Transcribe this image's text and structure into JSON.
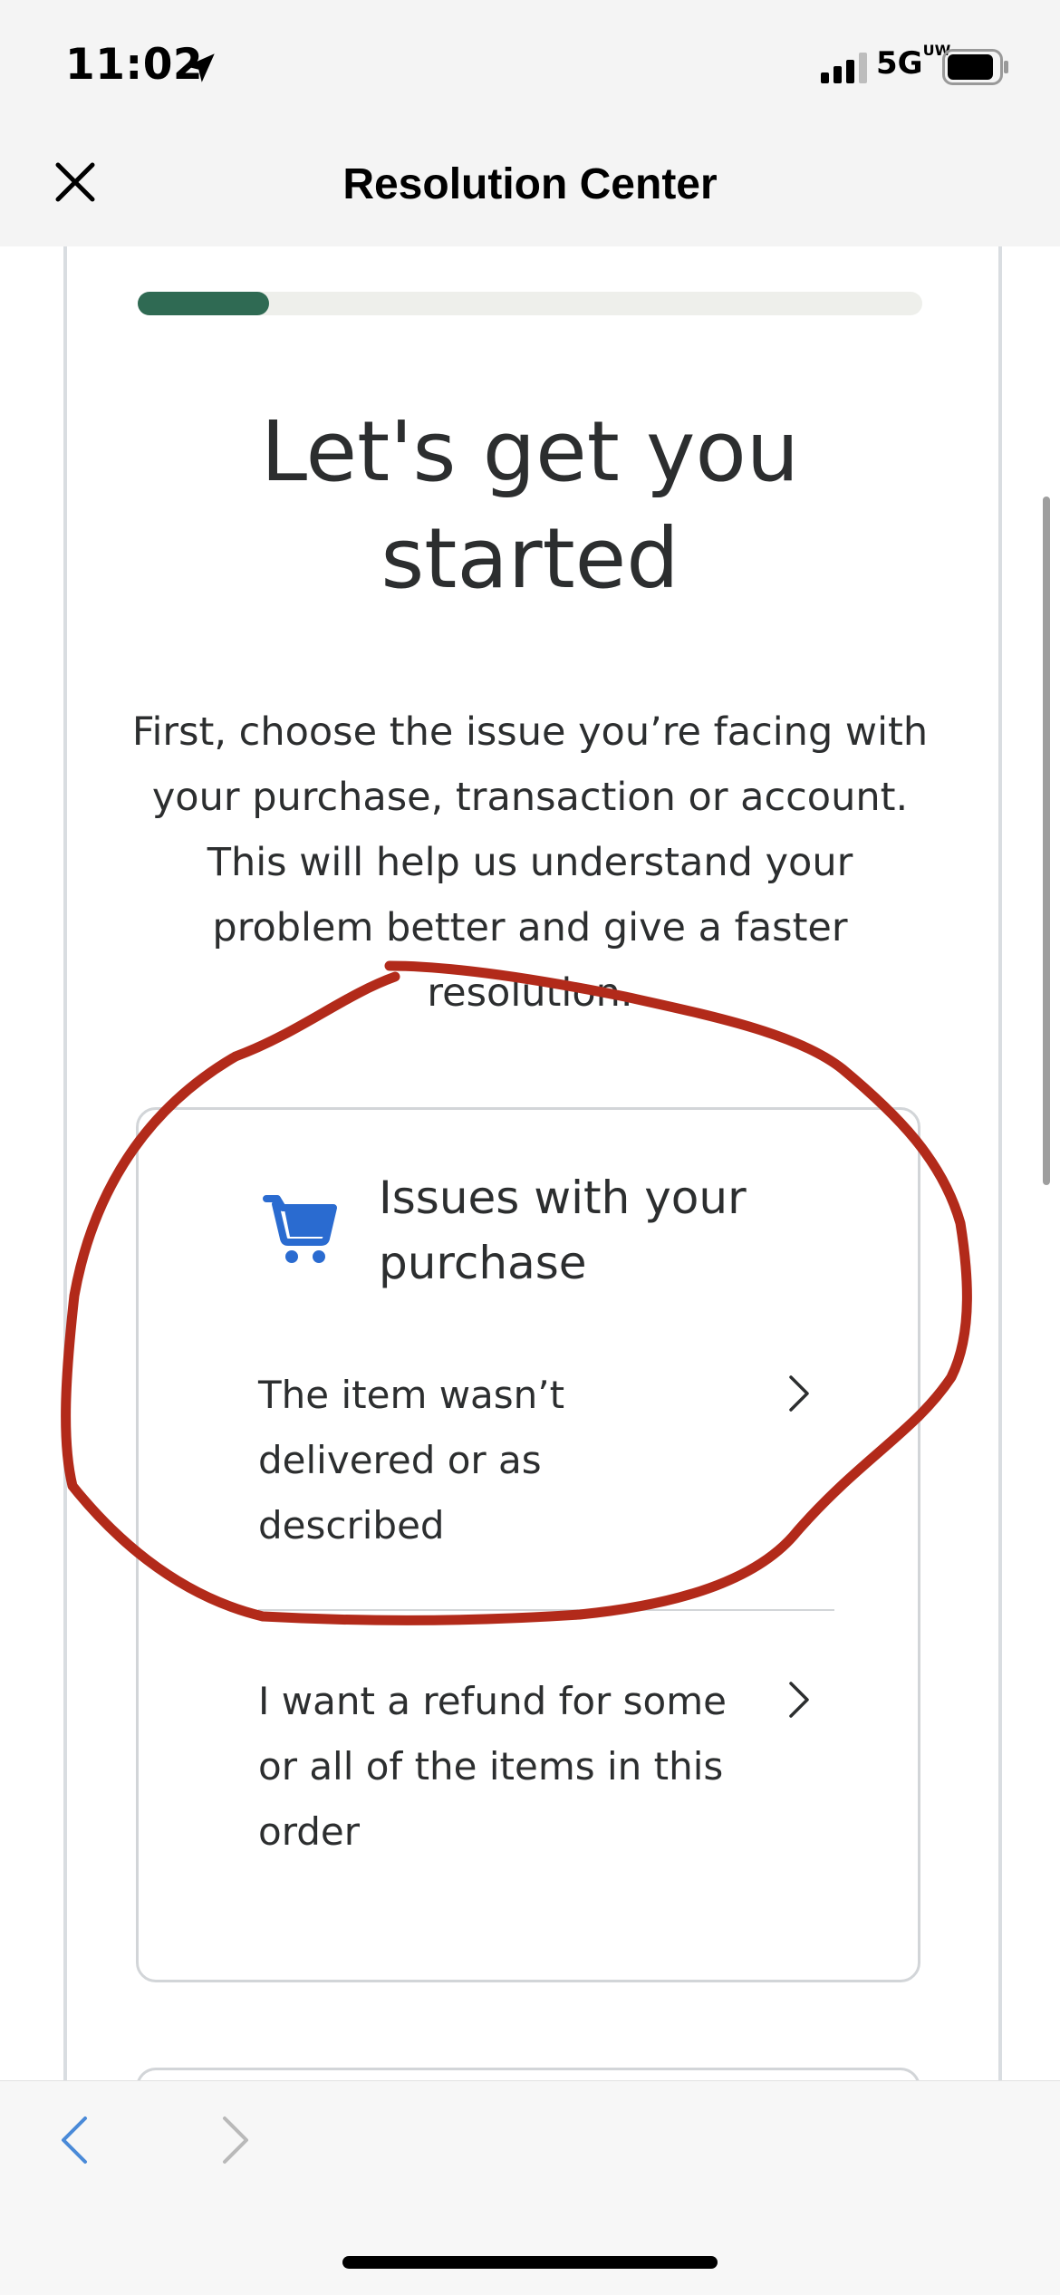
{
  "status_bar": {
    "time": "11:02",
    "network": "5G",
    "network_suffix": "UW"
  },
  "nav": {
    "title": "Resolution Center"
  },
  "progress": {
    "fraction": 0.167
  },
  "content": {
    "headline": "Let's get you started",
    "intro": "First, choose the issue you’re facing with your purchase, transaction or account. This will help us understand your problem better and give a faster resolution."
  },
  "card": {
    "icon": "shopping-cart-icon",
    "title": "Issues with your purchase",
    "options": [
      {
        "label": "The item wasn’t delivered or as described"
      },
      {
        "label": "I want a refund for some or all of the items in this order"
      }
    ]
  },
  "colors": {
    "accent": "#2f6a53",
    "cart_icon": "#2a6bd0",
    "annotation_stroke": "#b22a1a"
  }
}
